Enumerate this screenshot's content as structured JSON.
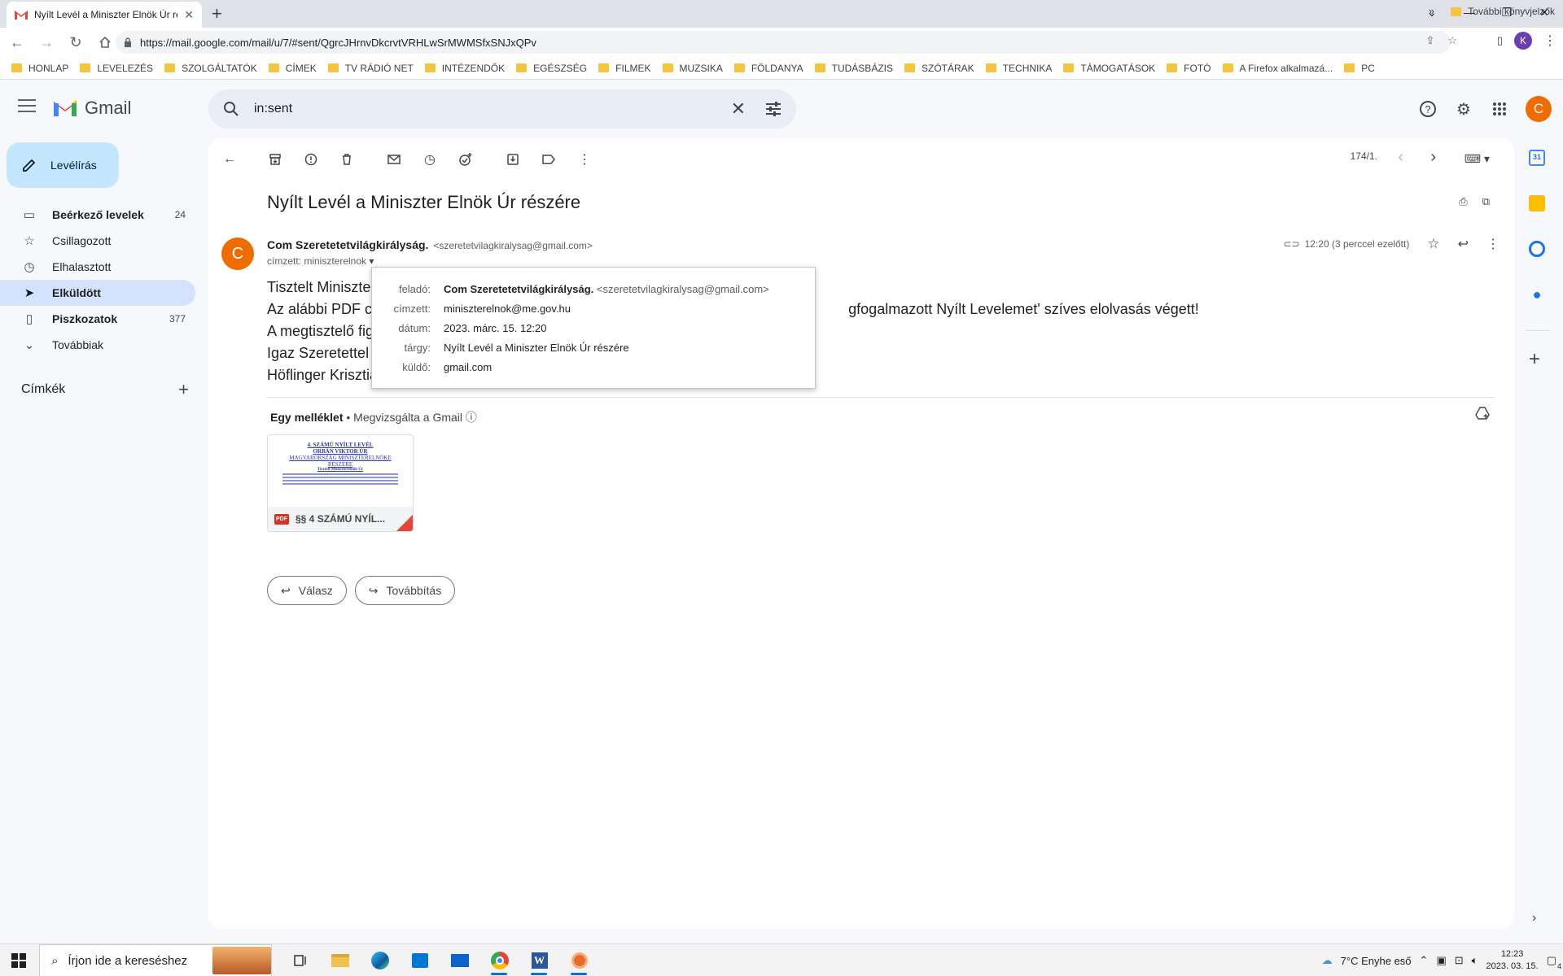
{
  "browser": {
    "tab_title": "Nyílt Levél a Miniszter Elnök Úr részére",
    "url": "https://mail.google.com/mail/u/7/#sent/QgrcJHrnvDkcrvtVRHLwSrMWMSfxSNJxQPv",
    "profile_initial": "K",
    "bookmarks": [
      "HONLAP",
      "LEVELEZÉS",
      "SZOLGÁLTATÓK",
      "CÍMEK",
      "TV RÁDIÓ NET",
      "INTÉZENDŐK",
      "EGÉSZSÉG",
      "FILMEK",
      "MUZSIKA",
      "FÖLDANYA",
      "TUDÁSBÁZIS",
      "SZÓTÁRAK",
      "TECHNIKA",
      "TÁMOGATÁSOK",
      "FOTÓ",
      "A Firefox alkalmazá...",
      "PC"
    ],
    "bookmarks_more": "»",
    "other_bookmarks": "További könyvjelzők"
  },
  "gmail": {
    "logo_text": "Gmail",
    "search_value": "in:sent",
    "account_initial": "C",
    "compose_label": "Levélírás",
    "nav": [
      {
        "label": "Beérkező levelek",
        "count": "24",
        "icon": "inbox-icon",
        "bold": true
      },
      {
        "label": "Csillagozott",
        "count": "",
        "icon": "star-icon",
        "bold": false
      },
      {
        "label": "Elhalasztott",
        "count": "",
        "icon": "clock-icon",
        "bold": false
      },
      {
        "label": "Elküldött",
        "count": "",
        "icon": "send-icon",
        "bold": true
      },
      {
        "label": "Piszkozatok",
        "count": "377",
        "icon": "draft-icon",
        "bold": true
      },
      {
        "label": "Továbbiak",
        "count": "",
        "icon": "chevron-down-icon",
        "bold": false
      }
    ],
    "labels_title": "Címkék"
  },
  "email": {
    "pager": "174/1.",
    "subject": "Nyílt Levél a Miniszter Elnök Úr részére",
    "sender_name": "Com Szeretetetvilágkirályság.",
    "sender_email": "<szeretetvilagkiralysag@gmail.com>",
    "recipient_line": "címzett: miniszterelnok",
    "time": "12:20 (3 perccel ezelőtt)",
    "body_lines": [
      "Tisztelt Miniszte",
      "Az alábbi PDF c                                                                                                                     gfogalmazott Nyílt Levelemet' szíves elolvasás végett!",
      "A megtisztelő fig",
      "Igaz Szeretettel",
      "Höflinger Krisztiá"
    ],
    "attachments_title": "Egy melléklet",
    "attachments_scanned": "• Megvizsgálta a Gmail",
    "attachment_name": "§§ 4 SZÁMÚ NYÍL...",
    "attachment_preview": [
      "4. SZÁMÚ NYÍLT LEVÉL",
      "ORBÁN VIKTOR ÚR",
      "MAGYARORSZÁG MINISZTERELNÖKE",
      "RÉSZÉRE",
      "Tisztelt Miniszterelnök Úr"
    ],
    "reply_label": "Válasz",
    "forward_label": "Továbbítás"
  },
  "popup": {
    "rows": [
      {
        "label": "feladó:",
        "value": "Com Szeretetetvilágkirályság.",
        "extra": "<szeretetvilagkiralysag@gmail.com>"
      },
      {
        "label": "címzett:",
        "value": "miniszterelnok@me.gov.hu",
        "extra": ""
      },
      {
        "label": "dátum:",
        "value": "2023. márc. 15. 12:20",
        "extra": ""
      },
      {
        "label": "tárgy:",
        "value": "Nyílt Levél a Miniszter Elnök Úr részére",
        "extra": ""
      },
      {
        "label": "küldő:",
        "value": "gmail.com",
        "extra": ""
      }
    ]
  },
  "taskbar": {
    "search_placeholder": "Írjon ide a kereséshez",
    "weather": "7°C  Enyhe eső",
    "time": "12:23",
    "date": "2023. 03. 15.",
    "notifications": "4"
  }
}
